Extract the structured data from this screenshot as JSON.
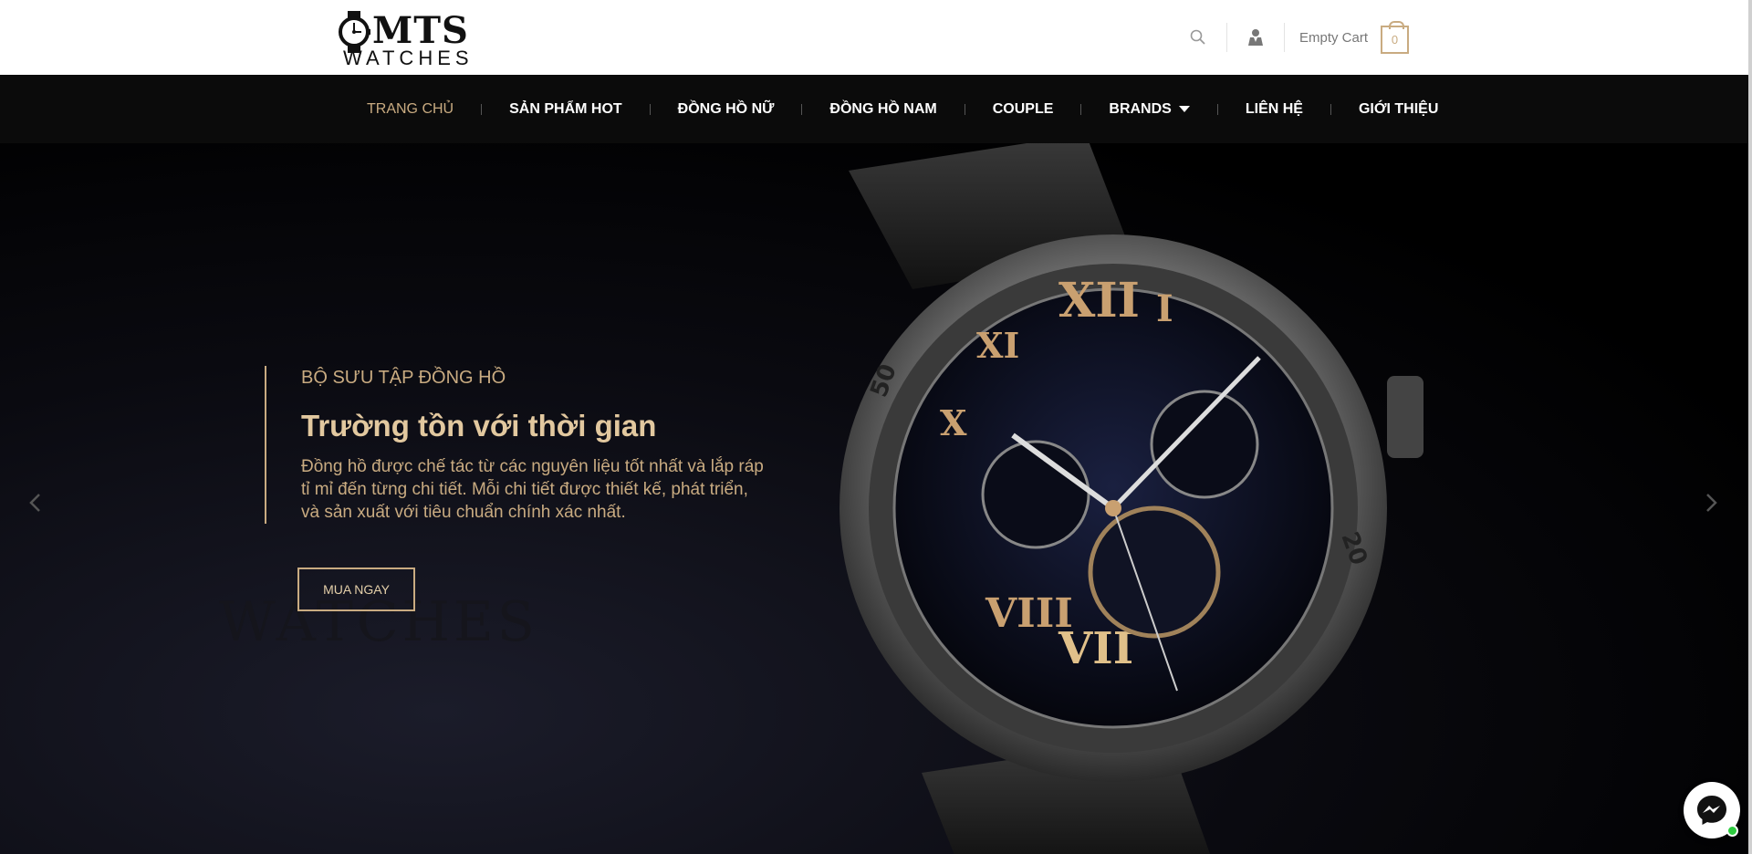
{
  "header": {
    "logo_main": "MTS",
    "logo_sub": "WATCHES",
    "cart_label": "Empty Cart",
    "cart_count": "0",
    "icons": [
      "search-icon",
      "user-icon",
      "cart-icon"
    ]
  },
  "nav": {
    "items": [
      {
        "label": "TRANG CHỦ",
        "active": true
      },
      {
        "label": "SẢN PHẨM HOT"
      },
      {
        "label": "ĐỒNG HỒ NỮ"
      },
      {
        "label": "ĐỒNG HỒ NAM"
      },
      {
        "label": "COUPLE"
      },
      {
        "label": "BRANDS",
        "dropdown": true
      },
      {
        "label": "LIÊN HỆ"
      },
      {
        "label": "GIỚI THIỆU"
      }
    ]
  },
  "hero": {
    "subtitle": "BỘ SƯU TẬP ĐỒNG HỒ",
    "title": "Trường tồn với thời gian",
    "description": "Đồng hồ được chế tác từ các nguyên liệu tốt nhất và lắp ráp tỉ mỉ đến từng chi tiết. Mỗi chi tiết được thiết kế, phát triển, và sản xuất với tiêu chuẩn chính xác nhất.",
    "button_label": "MUA NGAY",
    "ghost_text": "WATCHES"
  },
  "colors": {
    "accent": "#c9ab81",
    "nav_bg": "#0b0b0b",
    "header_bg": "#ffffff"
  }
}
